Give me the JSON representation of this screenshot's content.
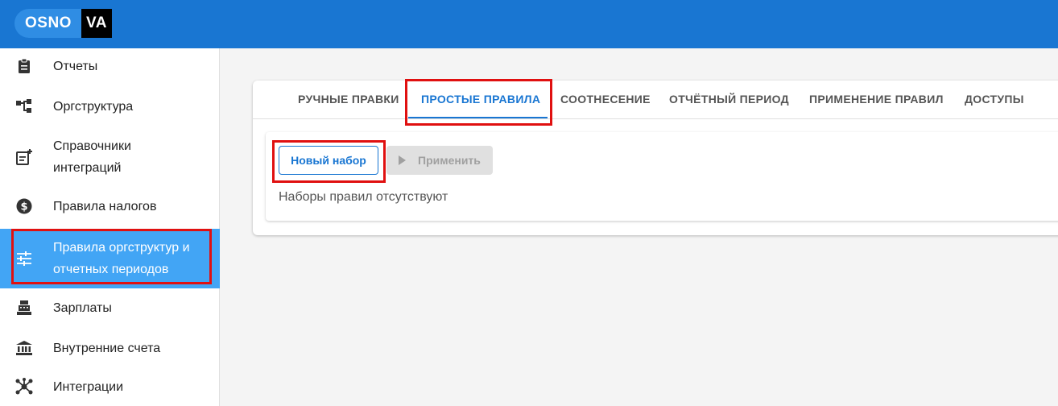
{
  "logo": {
    "left": "OSNO",
    "right": "VA"
  },
  "sidebar": {
    "items": [
      {
        "label": "Отчеты",
        "icon": "clipboard-icon"
      },
      {
        "label": "Оргструктура",
        "icon": "org-tree-icon"
      },
      {
        "label": "Справочники\nинтеграций",
        "icon": "list-add-icon"
      },
      {
        "label": "Правила налогов",
        "icon": "dollar-circle-icon"
      },
      {
        "label": "Правила оргструктур и\nотчетных периодов",
        "icon": "sliders-icon",
        "active": true
      },
      {
        "label": "Зарплаты",
        "icon": "cash-register-icon"
      },
      {
        "label": "Внутренние счета",
        "icon": "bank-icon"
      },
      {
        "label": "Интеграции",
        "icon": "hub-icon"
      }
    ]
  },
  "tabs": [
    {
      "label": "РУЧНЫЕ ПРАВКИ"
    },
    {
      "label": "ПРОСТЫЕ ПРАВИЛА",
      "active": true
    },
    {
      "label": "СООТНЕСЕНИЕ"
    },
    {
      "label": "ОТЧЁТНЫЙ ПЕРИОД"
    },
    {
      "label": "ПРИМЕНЕНИЕ ПРАВИЛ"
    },
    {
      "label": "ДОСТУПЫ"
    }
  ],
  "toolbar": {
    "new_set_label": "Новый набор",
    "apply_label": "Применить"
  },
  "content": {
    "empty_message": "Наборы правил отсутствуют"
  },
  "colors": {
    "header": "#1976d2",
    "accent": "#1976d2",
    "active_nav": "#42a5f5",
    "highlight": "#e01010"
  }
}
